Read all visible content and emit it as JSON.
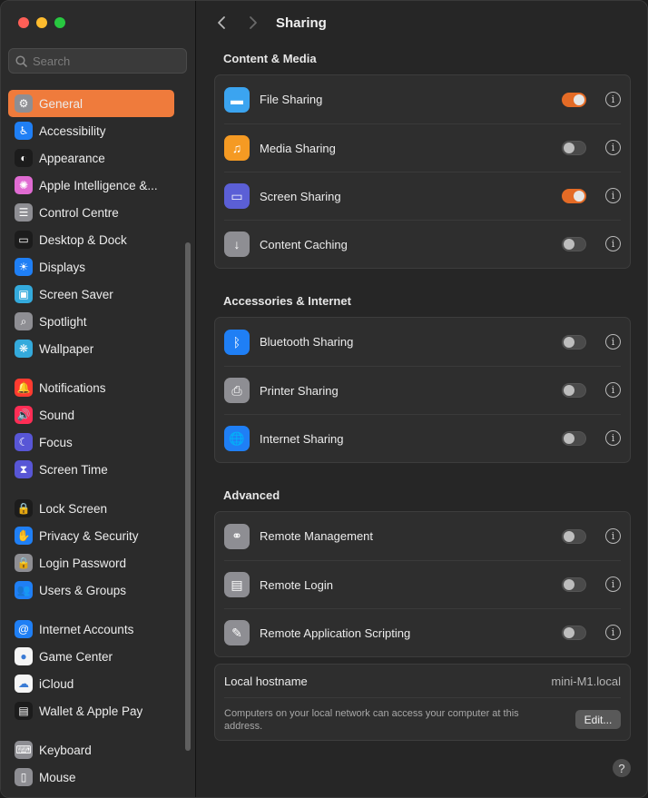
{
  "window": {
    "title": "Sharing"
  },
  "search": {
    "placeholder": "Search"
  },
  "sidebar": {
    "items": [
      {
        "label": "General",
        "icon": "gear-icon",
        "color": "#8e8e93",
        "glyph": "⚙",
        "selected": true
      },
      {
        "label": "Accessibility",
        "icon": "accessibility-icon",
        "color": "#1f7ff5",
        "glyph": "♿"
      },
      {
        "label": "Appearance",
        "icon": "appearance-icon",
        "color": "#1c1c1c",
        "glyph": "◐"
      },
      {
        "label": "Apple Intelligence &...",
        "icon": "apple-intelligence-icon",
        "color": "#e06bd2",
        "glyph": "✺"
      },
      {
        "label": "Control Centre",
        "icon": "control-centre-icon",
        "color": "#8e8e93",
        "glyph": "☰"
      },
      {
        "label": "Desktop & Dock",
        "icon": "desktop-dock-icon",
        "color": "#1c1c1c",
        "glyph": "▭"
      },
      {
        "label": "Displays",
        "icon": "displays-icon",
        "color": "#1f7ff5",
        "glyph": "☀"
      },
      {
        "label": "Screen Saver",
        "icon": "screen-saver-icon",
        "color": "#34aadc",
        "glyph": "▣"
      },
      {
        "label": "Spotlight",
        "icon": "spotlight-icon",
        "color": "#8e8e93",
        "glyph": "⌕"
      },
      {
        "label": "Wallpaper",
        "icon": "wallpaper-icon",
        "color": "#34aadc",
        "glyph": "❋"
      },
      {
        "gap": true
      },
      {
        "label": "Notifications",
        "icon": "notifications-icon",
        "color": "#ff3b30",
        "glyph": "🔔"
      },
      {
        "label": "Sound",
        "icon": "sound-icon",
        "color": "#ff2d55",
        "glyph": "🔊"
      },
      {
        "label": "Focus",
        "icon": "focus-icon",
        "color": "#5856d6",
        "glyph": "☾"
      },
      {
        "label": "Screen Time",
        "icon": "screen-time-icon",
        "color": "#5856d6",
        "glyph": "⧗"
      },
      {
        "gap": true
      },
      {
        "label": "Lock Screen",
        "icon": "lock-screen-icon",
        "color": "#1c1c1c",
        "glyph": "🔒"
      },
      {
        "label": "Privacy & Security",
        "icon": "privacy-hand-icon",
        "color": "#1f7ff5",
        "glyph": "✋"
      },
      {
        "label": "Login Password",
        "icon": "login-password-icon",
        "color": "#8e8e93",
        "glyph": "🔒"
      },
      {
        "label": "Users & Groups",
        "icon": "users-groups-icon",
        "color": "#1f7ff5",
        "glyph": "👥"
      },
      {
        "gap": true
      },
      {
        "label": "Internet Accounts",
        "icon": "at-sign-icon",
        "color": "#1f7ff5",
        "glyph": "@"
      },
      {
        "label": "Game Center",
        "icon": "game-center-icon",
        "color": "#f5f5f5",
        "glyph": "●"
      },
      {
        "label": "iCloud",
        "icon": "icloud-icon",
        "color": "#f5f5f5",
        "glyph": "☁"
      },
      {
        "label": "Wallet & Apple Pay",
        "icon": "wallet-icon",
        "color": "#1c1c1c",
        "glyph": "▤"
      },
      {
        "gap": true
      },
      {
        "label": "Keyboard",
        "icon": "keyboard-icon",
        "color": "#8e8e93",
        "glyph": "⌨"
      },
      {
        "label": "Mouse",
        "icon": "mouse-icon",
        "color": "#8e8e93",
        "glyph": "▯"
      }
    ]
  },
  "sections": [
    {
      "title": "Content & Media",
      "rows": [
        {
          "label": "File Sharing",
          "icon": "folder-icon",
          "color": "#3ba4f0",
          "glyph": "▬",
          "on": true
        },
        {
          "label": "Media Sharing",
          "icon": "media-sharing-icon",
          "color": "#f59a23",
          "glyph": "♫",
          "on": false
        },
        {
          "label": "Screen Sharing",
          "icon": "screen-sharing-icon",
          "color": "#5b5fd6",
          "glyph": "▭",
          "on": true
        },
        {
          "label": "Content Caching",
          "icon": "content-caching-icon",
          "color": "#8e8e93",
          "glyph": "↓",
          "on": false
        }
      ]
    },
    {
      "title": "Accessories & Internet",
      "rows": [
        {
          "label": "Bluetooth Sharing",
          "icon": "bluetooth-icon",
          "color": "#1f7ff5",
          "glyph": "ᛒ",
          "on": false
        },
        {
          "label": "Printer Sharing",
          "icon": "printer-icon",
          "color": "#8e8e93",
          "glyph": "⎙",
          "on": false
        },
        {
          "label": "Internet Sharing",
          "icon": "globe-icon",
          "color": "#1f7ff5",
          "glyph": "🌐",
          "on": false
        }
      ]
    },
    {
      "title": "Advanced",
      "rows": [
        {
          "label": "Remote Management",
          "icon": "binoculars-icon",
          "color": "#8e8e93",
          "glyph": "⚭",
          "on": false
        },
        {
          "label": "Remote Login",
          "icon": "remote-login-icon",
          "color": "#8e8e93",
          "glyph": "▤",
          "on": false
        },
        {
          "label": "Remote Application Scripting",
          "icon": "scripting-icon",
          "color": "#8e8e93",
          "glyph": "✎",
          "on": false
        }
      ]
    }
  ],
  "hostname": {
    "label": "Local hostname",
    "value": "mini-M1.local",
    "description": "Computers on your local network can access your computer at this address.",
    "edit_label": "Edit..."
  },
  "help": {
    "label": "?"
  },
  "accent": "#e46b26"
}
